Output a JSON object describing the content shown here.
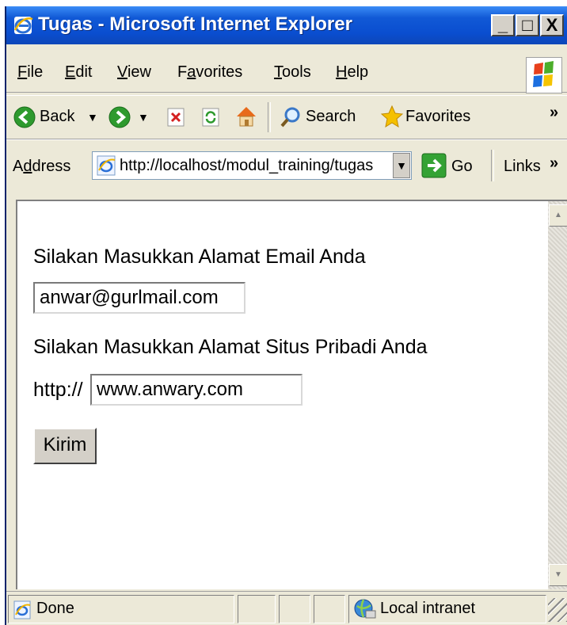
{
  "window": {
    "title": "Tugas - Microsoft Internet Explorer"
  },
  "window_buttons": {
    "minimize": "_",
    "maximize": "□",
    "close": "X"
  },
  "menu": {
    "items": [
      {
        "underline": "F",
        "rest": "ile"
      },
      {
        "underline": "E",
        "rest": "dit"
      },
      {
        "underline": "V",
        "rest": "iew"
      },
      {
        "prefix": "F",
        "underline": "a",
        "rest": "vorites"
      },
      {
        "underline": "T",
        "rest": "ools"
      },
      {
        "underline": "H",
        "rest": "elp"
      }
    ]
  },
  "toolbar": {
    "back_label": "Back",
    "search_label": "Search",
    "favorites_label": "Favorites",
    "more": "»"
  },
  "address": {
    "label_prefix": "A",
    "label_underline": "d",
    "label_rest": "dress",
    "url": "http://localhost/modul_training/tugas",
    "go_label": "Go",
    "links_label": "Links",
    "links_more": "»"
  },
  "page": {
    "email_prompt": "Silakan Masukkan Alamat Email Anda",
    "email_value": "anwar@gurlmail.com",
    "site_prompt": "Silakan Masukkan Alamat Situs Pribadi Anda",
    "url_prefix": "http://",
    "site_value": "www.anwary.com",
    "submit_label": "Kirim"
  },
  "status": {
    "text": "Done",
    "zone": "Local intranet"
  }
}
